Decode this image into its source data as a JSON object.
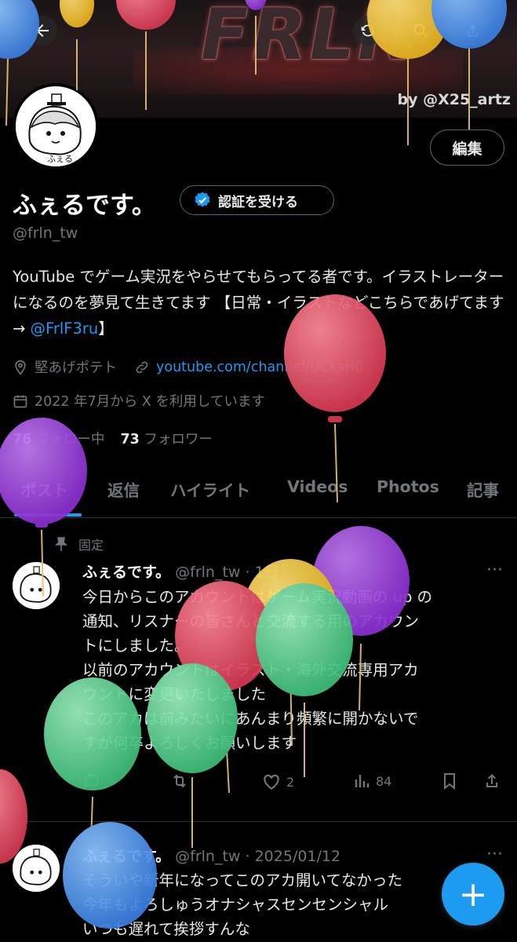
{
  "banner": {
    "logo_text": "FRLN",
    "credit": "by @X25_artz"
  },
  "topbar": {
    "back_icon": "arrow-left-icon",
    "refresh_icon": "refresh-icon",
    "search_icon": "search-icon",
    "share_icon": "share-icon"
  },
  "profile": {
    "edit_label": "編集",
    "display_name": "ふぇるです。",
    "verify_label": "認証を受ける",
    "handle": "@frln_tw",
    "bio_text": "YouTube でゲーム実況をやらせてもらってる者です。イラストレーターになるのを夢見て生きてます 【日常・イラストなどこちらであげてます→ ",
    "bio_mention": "@FrlF3ru",
    "bio_end": "】",
    "location": "堅あげポテト",
    "website": "youtube.com/channel/UCksH0...",
    "joined": "2022 年7月から X を利用しています",
    "following_count": "76",
    "following_label": "フォロー中",
    "followers_count": "73",
    "followers_label": "フォロワー"
  },
  "tabs": [
    "ポスト",
    "返信",
    "ハイライト",
    "Videos",
    "Photos",
    "記事"
  ],
  "pinned_label": "固定",
  "posts": [
    {
      "name": "ふぇるです。",
      "meta": "@frln_tw · 1日",
      "lines": [
        "今日からこのアカウントはゲーム実況動画の up の",
        "通知、リスナーの皆さんと交流する用のアカウン",
        "トにしました。",
        "以前のアカウントはイラスト・海外交流専用アカ",
        "ウントに変更いたしました",
        "このアカは前みたいにあんまり頻繁に開かないで",
        "すが何卒よろしくお願いします"
      ],
      "likes": "2",
      "views": "84"
    },
    {
      "name": "ふぇるです。",
      "meta": "@frln_tw · 2025/01/12",
      "lines": [
        "そういや新年になってこのアカ開いてなかった",
        "今年もよろしゅうオナシャスセンセンシャル",
        "いつも遅れて挨拶すんな"
      ]
    }
  ],
  "fab_label": "+",
  "colors": {
    "accent": "#1d9bf0",
    "background": "#000000",
    "text": "#e7e9ea",
    "muted": "#71767b"
  }
}
